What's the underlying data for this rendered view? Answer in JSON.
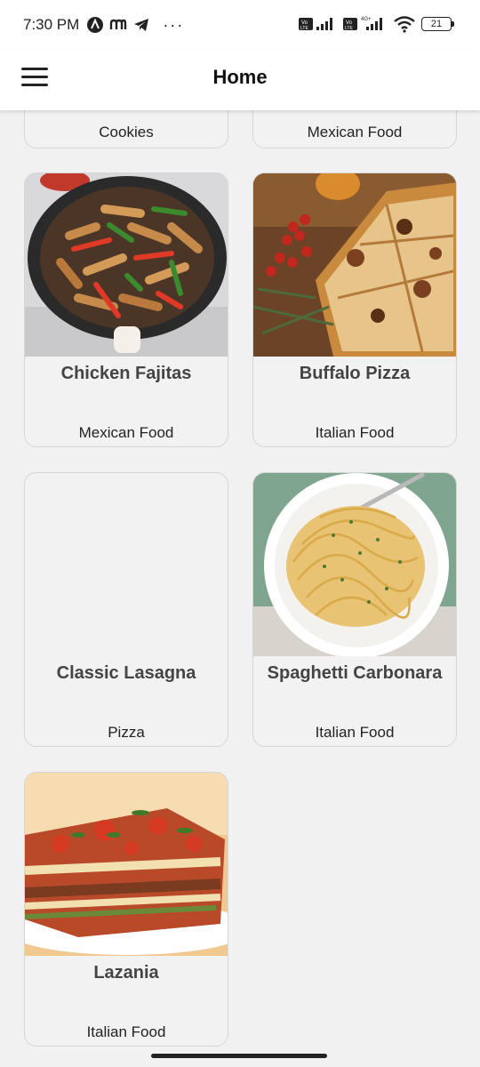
{
  "status_bar": {
    "time": "7:30 PM",
    "battery": "21",
    "network_label": "4G+"
  },
  "app_bar": {
    "title": "Home"
  },
  "recipes": [
    {
      "name": "",
      "category": "Cookies"
    },
    {
      "name": "",
      "category": "Mexican Food"
    },
    {
      "name": "Chicken Fajitas",
      "category": "Mexican Food"
    },
    {
      "name": "Buffalo Pizza",
      "category": "Italian Food"
    },
    {
      "name": "Classic Lasagna",
      "category": "Pizza"
    },
    {
      "name": "Spaghetti Carbonara",
      "category": "Italian Food"
    },
    {
      "name": "Lazania",
      "category": "Italian Food"
    }
  ]
}
